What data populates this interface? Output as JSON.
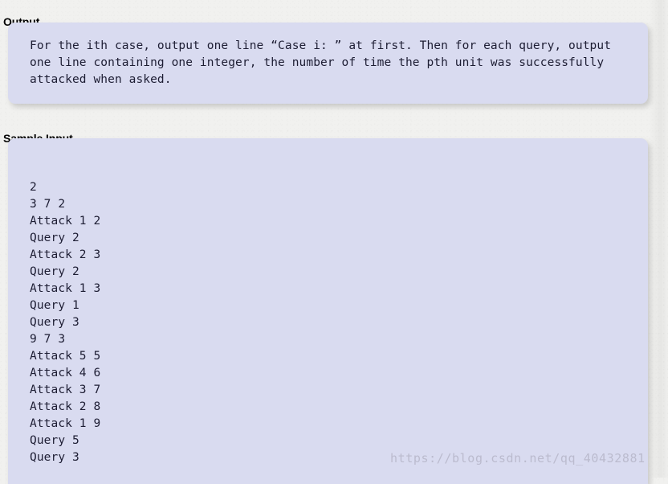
{
  "sections": {
    "output": {
      "heading": "Output",
      "body": "For the ith case, output one line “Case i: ” at first. Then for each query, output\none line containing one integer, the number of time the pth unit was successfully\nattacked when asked."
    },
    "sample_input": {
      "heading": "Sample Input",
      "lines": [
        "2",
        "3 7 2",
        "Attack 1 2",
        "Query 2",
        "Attack 2 3",
        "Query 2",
        "Attack 1 3",
        "Query 1",
        "Query 3",
        "9 7 3",
        "Attack 5 5",
        "Attack 4 6",
        "Attack 3 7",
        "Attack 2 8",
        "Attack 1 9",
        "Query 5",
        "Query 3"
      ],
      "body": "2\n3 7 2\nAttack 1 2\nQuery 2\nAttack 2 3\nQuery 2\nAttack 1 3\nQuery 1\nQuery 3\n9 7 3\nAttack 5 5\nAttack 4 6\nAttack 3 7\nAttack 2 8\nAttack 1 9\nQuery 5\nQuery 3"
    }
  },
  "watermark": {
    "text": "https://blog.csdn.net/qq_40432881"
  },
  "colors": {
    "page_background": "#f1f1ef",
    "box_background": "#d9dbf0",
    "heading_text": "#020202",
    "code_text": "#1d1d33",
    "watermark_text": "#918ea0"
  }
}
